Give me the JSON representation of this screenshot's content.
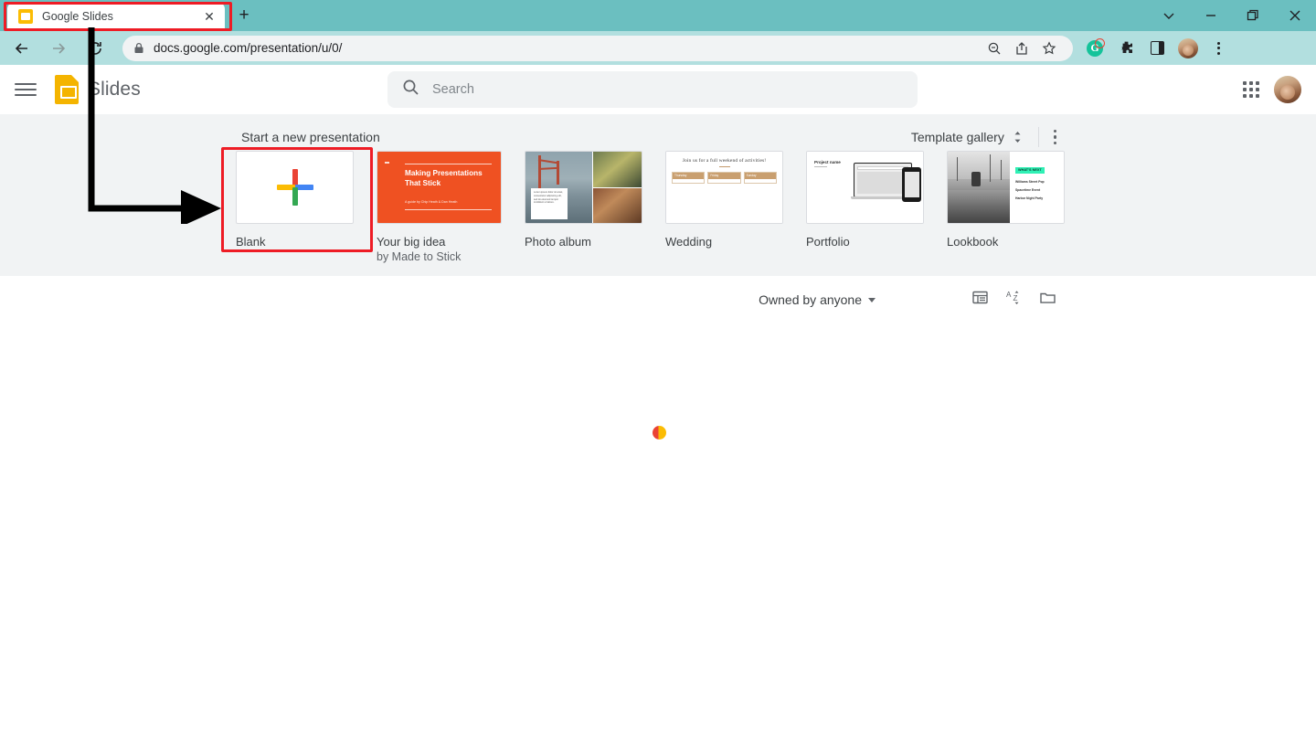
{
  "browser": {
    "tab": {
      "title": "Google Slides",
      "favicon": "slides-favicon",
      "close_label": "✕"
    },
    "new_tab_label": "+",
    "window_controls": {
      "chevron": "⌄",
      "minimize": "—",
      "restore": "❐",
      "close": "✕"
    },
    "nav": {
      "back": "←",
      "forward": "→",
      "reload": "↻"
    },
    "omnibox": {
      "url": "docs.google.com/presentation/u/0/",
      "lock_icon": "lock-icon",
      "actions": [
        "zoom-out-icon",
        "share-icon",
        "bookmark-star-icon"
      ]
    },
    "extensions": {
      "grammarly_letter": "G",
      "puzzle_icon": "extensions-puzzle-icon",
      "panel_icon": "side-panel-icon",
      "profile_icon": "browser-profile-avatar",
      "menu_icon": "chrome-menu-icon"
    }
  },
  "app": {
    "menu_label": "main-menu",
    "product_name": "Slides",
    "logo": "google-slides-logo",
    "search": {
      "placeholder": "Search",
      "value": "",
      "icon": "search-icon"
    },
    "apps_grid_label": "google-apps",
    "account_label": "google-account-avatar"
  },
  "templates": {
    "heading": "Start a new presentation",
    "gallery_link": "Template gallery",
    "sorter_icon": "expand-collapse-icon",
    "more_icon": "more-options-icon",
    "cards": [
      {
        "label": "Blank",
        "sub": "",
        "thumb": "blank-plus"
      },
      {
        "label": "Your big idea",
        "sub": "by Made to Stick",
        "thumb": "big-idea",
        "headline": "Making Presentations That Stick",
        "byline": "A guide by Chip Heath & Dan Heath"
      },
      {
        "label": "Photo album",
        "sub": "",
        "thumb": "photo-album",
        "caption": "Lorem ipsum dolor sit amet, consectetur adipiscing elit, sed do eiusmod tempor incididunt ut labore."
      },
      {
        "label": "Wedding",
        "sub": "",
        "thumb": "wedding",
        "title": "Join us for a full weekend of activities!",
        "columns": [
          "Thursday",
          "Friday",
          "Sunday"
        ]
      },
      {
        "label": "Portfolio",
        "sub": "",
        "thumb": "portfolio",
        "title": "Project name"
      },
      {
        "label": "Lookbook",
        "sub": "",
        "thumb": "lookbook",
        "tag": "WHAT'S NEXT",
        "items": [
          "Williams Street Pop",
          "Spacetime Event",
          "Harbor Night Party"
        ]
      }
    ]
  },
  "file_list": {
    "owner_filter": "Owned by anyone",
    "view_icon": "list-view-icon",
    "sort_icon": "sort-az-icon",
    "folder_icon": "file-picker-folder-icon",
    "loading": "loading-spinner"
  },
  "annotations": {
    "tab_highlight": "red-box-around-tab",
    "card_highlight": "red-box-around-blank-card",
    "arrow": "black-elbow-arrow-pointing-to-blank-card"
  },
  "colors": {
    "chrome_titlebar": "#6bbfc0",
    "chrome_toolbar": "#b2dfdf",
    "band_background": "#f1f3f4",
    "slides_yellow": "#f4b400",
    "annotation_red": "#ee1c25",
    "bigidea_orange": "#ef5122",
    "lookbook_tag": "#2ff0b5"
  }
}
